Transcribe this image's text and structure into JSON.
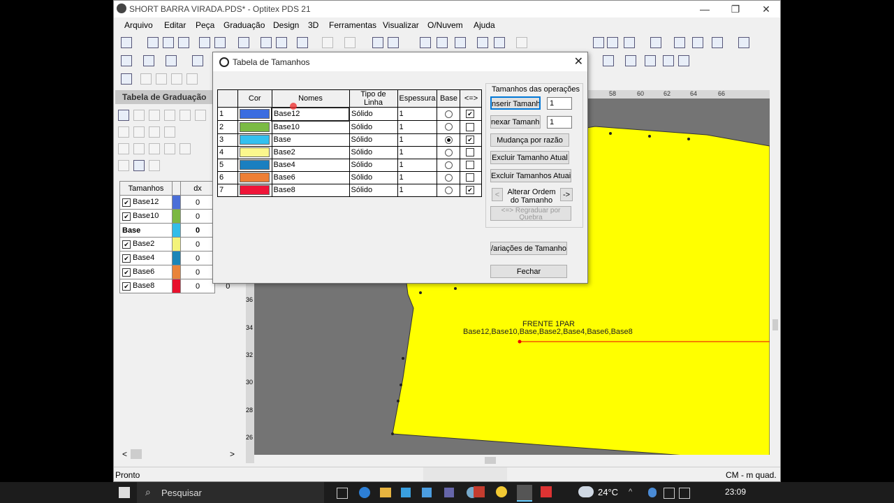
{
  "window": {
    "title": "SHORT BARRA VIRADA.PDS* - Optitex PDS 21",
    "minimize": "—",
    "restore": "❐",
    "close": "✕"
  },
  "menu": [
    "Arquivo",
    "Editar",
    "Peça",
    "Graduação",
    "Design",
    "3D",
    "Ferramentas",
    "Visualizar",
    "O/Nuvem",
    "Ajuda"
  ],
  "left_panel": {
    "title": "Tabela de Graduação",
    "grid_headers": [
      "Tamanhos",
      "dx"
    ],
    "rows": [
      {
        "name": "Base12",
        "dx": "0",
        "color": "#4a6fd8",
        "checked": true
      },
      {
        "name": "Base10",
        "dx": "0",
        "color": "#7bb843",
        "checked": true
      },
      {
        "name": "Base",
        "dx": "0",
        "color": "#33bde8",
        "checked": false,
        "bold": true
      },
      {
        "name": "Base2",
        "dx": "0",
        "color": "#f3f37a",
        "checked": true
      },
      {
        "name": "Base4",
        "dx": "0",
        "color": "#1a86b8",
        "checked": true
      },
      {
        "name": "Base6",
        "dx": "0",
        "color": "#e9843a",
        "checked": true
      },
      {
        "name": "Base8",
        "dx": "0",
        "color": "#e8102c",
        "checked": true,
        "extra": "0"
      }
    ],
    "scroll_left": "<",
    "scroll_right": ">"
  },
  "dialog": {
    "title": "Tabela de Tamanhos",
    "close": "✕",
    "headers": [
      "Cor",
      "Nomes",
      "Tipo de Linha",
      "Espessura",
      "Base",
      "<=>"
    ],
    "rows": [
      {
        "num": "1",
        "color": "#3b6de0",
        "name": "Base12",
        "line": "Sólido",
        "width": "1",
        "base": false,
        "swap": true
      },
      {
        "num": "2",
        "color": "#7bbb45",
        "name": "Base10",
        "line": "Sólido",
        "width": "1",
        "base": false,
        "swap": false
      },
      {
        "num": "3",
        "color": "#33c0ef",
        "name": "Base",
        "line": "Sólido",
        "width": "1",
        "base": true,
        "swap": true
      },
      {
        "num": "4",
        "color": "#fbf78d",
        "name": "Base2",
        "line": "Sólido",
        "width": "1",
        "base": false,
        "swap": false
      },
      {
        "num": "5",
        "color": "#1a7fc0",
        "name": "Base4",
        "line": "Sólido",
        "width": "1",
        "base": false,
        "swap": false
      },
      {
        "num": "6",
        "color": "#ee7f35",
        "name": "Base6",
        "line": "Sólido",
        "width": "1",
        "base": false,
        "swap": false
      },
      {
        "num": "7",
        "color": "#ef1538",
        "name": "Base8",
        "line": "Sólido",
        "width": "1",
        "base": false,
        "swap": true
      }
    ],
    "group_label": "Tamanhos das operações",
    "insert_btn": "nserir Tamanho",
    "insert_value": "1",
    "annex_btn": "nexar Tamanho",
    "annex_value": "1",
    "ratio_btn": "Mudança por razão",
    "delete_current_btn": "Excluir Tamanho Atual",
    "delete_all_btn": "Excluir Tamanhos Atuais",
    "order_prev": "<",
    "order_label": "Alterar Ordem do Tamanho",
    "order_next": "->",
    "regrade_btn": "<=> Regraduar por Quebra",
    "variations_btn": "/ariações de Tamanho..",
    "close_btn": "Fechar"
  },
  "canvas": {
    "piece_label": "FRENTE 1PAR",
    "piece_sizes": "Base12,Base10,Base,Base2,Base4,Base6,Base8",
    "ruler_top": [
      "58",
      "60",
      "62",
      "64",
      "66"
    ],
    "ruler_left": [
      "36",
      "34",
      "32",
      "30",
      "28",
      "26"
    ]
  },
  "status": {
    "left": "Pronto",
    "right": "CM - m quad."
  },
  "taskbar": {
    "search": "Pesquisar",
    "temp": "24°C",
    "time": "23:09"
  }
}
